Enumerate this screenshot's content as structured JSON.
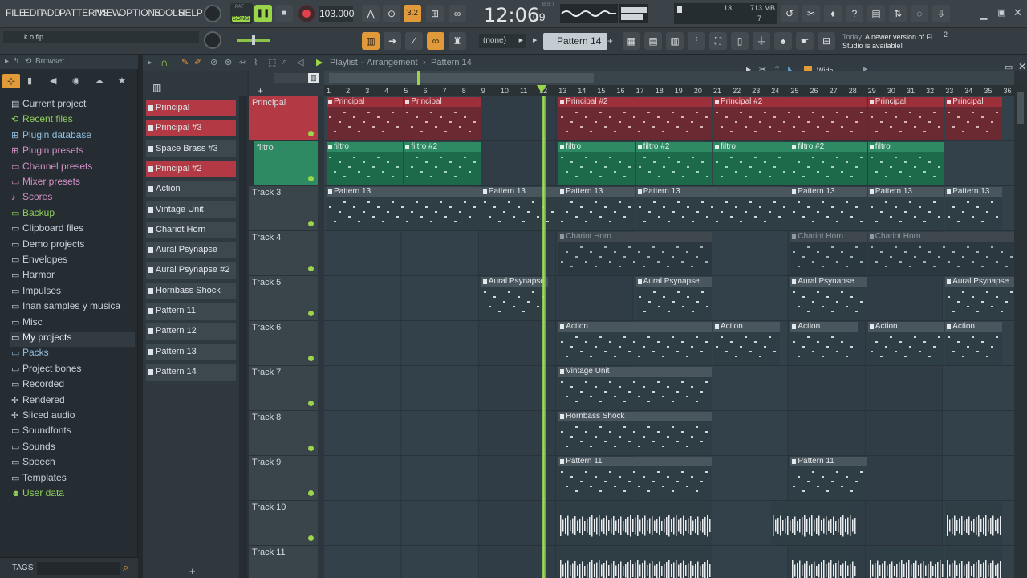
{
  "menu": [
    "FILE",
    "EDIT",
    "ADD",
    "PATTERNS",
    "VIEW",
    "OPTIONS",
    "TOOLS",
    "HELP"
  ],
  "transport": {
    "mode_top": "PAT",
    "mode_bottom": "SONG",
    "tempo": "103.000",
    "time": "12:06",
    "time_sub": "09",
    "time_label": "B:S:T",
    "step": "3.2"
  },
  "cpu": {
    "memory": "713 MB",
    "voices": "13",
    "polyphony": "7"
  },
  "hint_bar": {
    "file": "k.o.flp"
  },
  "toolbar2": {
    "snap": "(none)",
    "pattern": "Pattern 14",
    "news_date": "Today",
    "news_text": "A newer version of FL Studio is available!",
    "news_count": "2"
  },
  "browser": {
    "title": "Browser",
    "items": [
      {
        "label": "Current project",
        "icon": "project-icon",
        "color": "#c8d2d8"
      },
      {
        "label": "Recent files",
        "icon": "recent-icon",
        "color": "#8fd05b"
      },
      {
        "label": "Plugin database",
        "icon": "plugin-icon",
        "color": "#8fbfe0"
      },
      {
        "label": "Plugin presets",
        "icon": "plugin-preset-icon",
        "color": "#d390c7"
      },
      {
        "label": "Channel presets",
        "icon": "channel-preset-icon",
        "color": "#d390c7"
      },
      {
        "label": "Mixer presets",
        "icon": "mixer-preset-icon",
        "color": "#d390c7"
      },
      {
        "label": "Scores",
        "icon": "score-icon",
        "color": "#d390c7"
      },
      {
        "label": "Backup",
        "icon": "backup-icon",
        "color": "#8fd05b"
      },
      {
        "label": "Clipboard files",
        "icon": "folder-icon",
        "color": "#c8d2d8"
      },
      {
        "label": "Demo projects",
        "icon": "folder-icon",
        "color": "#c8d2d8"
      },
      {
        "label": "Envelopes",
        "icon": "folder-icon",
        "color": "#c8d2d8"
      },
      {
        "label": "Harmor",
        "icon": "folder-icon",
        "color": "#c8d2d8"
      },
      {
        "label": "Impulses",
        "icon": "folder-icon",
        "color": "#c8d2d8"
      },
      {
        "label": "Inan samples y musica",
        "icon": "folder-icon",
        "color": "#c8d2d8"
      },
      {
        "label": "Misc",
        "icon": "folder-icon",
        "color": "#c8d2d8"
      },
      {
        "label": "My projects",
        "icon": "folder-icon",
        "color": "#e8eef1"
      },
      {
        "label": "Packs",
        "icon": "pack-icon",
        "color": "#8fbfe0"
      },
      {
        "label": "Project bones",
        "icon": "project-bones-icon",
        "color": "#c8d2d8"
      },
      {
        "label": "Recorded",
        "icon": "recorded-icon",
        "color": "#c8d2d8"
      },
      {
        "label": "Rendered",
        "icon": "rendered-icon",
        "color": "#c8d2d8"
      },
      {
        "label": "Sliced audio",
        "icon": "sliced-icon",
        "color": "#c8d2d8"
      },
      {
        "label": "Soundfonts",
        "icon": "folder-icon",
        "color": "#c8d2d8"
      },
      {
        "label": "Sounds",
        "icon": "sounds-icon",
        "color": "#c8d2d8"
      },
      {
        "label": "Speech",
        "icon": "folder-icon",
        "color": "#c8d2d8"
      },
      {
        "label": "Templates",
        "icon": "folder-icon",
        "color": "#c8d2d8"
      },
      {
        "label": "User data",
        "icon": "user-icon",
        "color": "#8fd05b"
      }
    ],
    "footer": "TAGS"
  },
  "playlist": {
    "title": "Playlist",
    "breadcrumb1": "Arrangement",
    "breadcrumb2": "Pattern 14",
    "zoom": "Wide"
  },
  "channels": [
    {
      "label": "Principal",
      "red": true
    },
    {
      "label": "Principal #3",
      "red": true
    },
    {
      "label": "Space Brass #3",
      "red": false
    },
    {
      "label": "Principal #2",
      "red": true
    },
    {
      "label": "Action",
      "red": false
    },
    {
      "label": "Vintage Unit",
      "red": false
    },
    {
      "label": "Chariot Horn",
      "red": false
    },
    {
      "label": "Aural Psynapse",
      "red": false
    },
    {
      "label": "Aural Psynapse #2",
      "red": false
    },
    {
      "label": "Hornbass Shock",
      "red": false
    },
    {
      "label": "Pattern 11",
      "red": false
    },
    {
      "label": "Pattern 12",
      "red": false
    },
    {
      "label": "Pattern 13",
      "red": false
    },
    {
      "label": "Pattern 14",
      "red": false
    }
  ],
  "ruler": [
    "1",
    "2",
    "3",
    "4",
    "5",
    "6",
    "7",
    "8",
    "9",
    "10",
    "11",
    "12",
    "13",
    "14",
    "15",
    "16",
    "17",
    "18",
    "19",
    "20",
    "21",
    "22",
    "23",
    "24",
    "25",
    "26",
    "27",
    "28",
    "29",
    "30",
    "31",
    "32",
    "33",
    "34",
    "35",
    "36"
  ],
  "tracks": [
    {
      "label": "Principal",
      "color": "#b33a44"
    },
    {
      "label": "filtro",
      "color": "#2e8a62"
    },
    {
      "label": "Track 3",
      "color": "#3a444b"
    },
    {
      "label": "Track 4",
      "color": "#3a444b"
    },
    {
      "label": "Track 5",
      "color": "#3a444b"
    },
    {
      "label": "Track 6",
      "color": "#3a444b"
    },
    {
      "label": "Track 7",
      "color": "#3a444b"
    },
    {
      "label": "Track 8",
      "color": "#3a444b"
    },
    {
      "label": "Track 9",
      "color": "#3a444b"
    },
    {
      "label": "Track 10",
      "color": "#3a444b"
    },
    {
      "label": "Track 11",
      "color": "#3a444b"
    }
  ],
  "clips": [
    {
      "track": 0,
      "bar": 1,
      "len": 4,
      "label": "Principal",
      "kind": "red"
    },
    {
      "track": 0,
      "bar": 5,
      "len": 4,
      "label": "Principal",
      "kind": "red"
    },
    {
      "track": 0,
      "bar": 13,
      "len": 8,
      "label": "Principal #2",
      "kind": "red"
    },
    {
      "track": 0,
      "bar": 21,
      "len": 8,
      "label": "Principal #2",
      "kind": "red"
    },
    {
      "track": 0,
      "bar": 29,
      "len": 4,
      "label": "Principal",
      "kind": "red"
    },
    {
      "track": 0,
      "bar": 33,
      "len": 3,
      "label": "Principal",
      "kind": "red"
    },
    {
      "track": 1,
      "bar": 1,
      "len": 4,
      "label": "filtro",
      "kind": "green"
    },
    {
      "track": 1,
      "bar": 5,
      "len": 4,
      "label": "filtro #2",
      "kind": "green"
    },
    {
      "track": 1,
      "bar": 13,
      "len": 4,
      "label": "filtro",
      "kind": "green"
    },
    {
      "track": 1,
      "bar": 17,
      "len": 4,
      "label": "filtro #2",
      "kind": "green"
    },
    {
      "track": 1,
      "bar": 21,
      "len": 4,
      "label": "filtro",
      "kind": "green"
    },
    {
      "track": 1,
      "bar": 25,
      "len": 4,
      "label": "filtro #2",
      "kind": "green"
    },
    {
      "track": 1,
      "bar": 29,
      "len": 4,
      "label": "filtro",
      "kind": "green"
    },
    {
      "track": 2,
      "bar": 1,
      "len": 8,
      "label": "Pattern 13",
      "kind": "grey"
    },
    {
      "track": 2,
      "bar": 9,
      "len": 4,
      "label": "Pattern 13",
      "kind": "grey"
    },
    {
      "track": 2,
      "bar": 13,
      "len": 4,
      "label": "Pattern 13",
      "kind": "grey"
    },
    {
      "track": 2,
      "bar": 17,
      "len": 8,
      "label": "Pattern 13",
      "kind": "grey"
    },
    {
      "track": 2,
      "bar": 25,
      "len": 4,
      "label": "Pattern 13",
      "kind": "grey"
    },
    {
      "track": 2,
      "bar": 29,
      "len": 4,
      "label": "Pattern 13",
      "kind": "grey"
    },
    {
      "track": 2,
      "bar": 33,
      "len": 3,
      "label": "Pattern 13",
      "kind": "grey"
    },
    {
      "track": 3,
      "bar": 13,
      "len": 8,
      "label": "Chariot Horn",
      "kind": "muted"
    },
    {
      "track": 3,
      "bar": 25,
      "len": 4,
      "label": "Chariot Horn",
      "kind": "muted"
    },
    {
      "track": 3,
      "bar": 29,
      "len": 8,
      "label": "Chariot Horn",
      "kind": "muted"
    },
    {
      "track": 4,
      "bar": 9,
      "len": 3.5,
      "label": "Aural Psynapse",
      "kind": "grey"
    },
    {
      "track": 4,
      "bar": 17,
      "len": 4,
      "label": "Aural Psynapse",
      "kind": "grey"
    },
    {
      "track": 4,
      "bar": 25,
      "len": 4,
      "label": "Aural Psynapse",
      "kind": "grey"
    },
    {
      "track": 4,
      "bar": 33,
      "len": 4,
      "label": "Aural Psynapse",
      "kind": "grey"
    },
    {
      "track": 5,
      "bar": 13,
      "len": 8,
      "label": "Action",
      "kind": "grey"
    },
    {
      "track": 5,
      "bar": 21,
      "len": 3.5,
      "label": "Action",
      "kind": "grey"
    },
    {
      "track": 5,
      "bar": 25,
      "len": 3.5,
      "label": "Action",
      "kind": "grey"
    },
    {
      "track": 5,
      "bar": 29,
      "len": 4,
      "label": "Action",
      "kind": "grey"
    },
    {
      "track": 5,
      "bar": 33,
      "len": 3,
      "label": "Action",
      "kind": "grey"
    },
    {
      "track": 6,
      "bar": 13,
      "len": 8,
      "label": "Vintage Unit",
      "kind": "grey"
    },
    {
      "track": 7,
      "bar": 13,
      "len": 8,
      "label": "Hornbass Shock",
      "kind": "grey"
    },
    {
      "track": 8,
      "bar": 13,
      "len": 8,
      "label": "Pattern 11",
      "kind": "grey"
    },
    {
      "track": 8,
      "bar": 25,
      "len": 4,
      "label": "Pattern 11",
      "kind": "grey"
    },
    {
      "track": 9,
      "bar": 13,
      "len": 8,
      "label": "",
      "kind": "audio"
    },
    {
      "track": 9,
      "bar": 24,
      "len": 4.5,
      "label": "",
      "kind": "audio"
    },
    {
      "track": 9,
      "bar": 33,
      "len": 3,
      "label": "",
      "kind": "audio"
    },
    {
      "track": 10,
      "bar": 13,
      "len": 8,
      "label": "",
      "kind": "audio"
    },
    {
      "track": 10,
      "bar": 25,
      "len": 3.5,
      "label": "",
      "kind": "audio"
    },
    {
      "track": 10,
      "bar": 29,
      "len": 4,
      "label": "",
      "kind": "audio"
    },
    {
      "track": 10,
      "bar": 33,
      "len": 3,
      "label": "",
      "kind": "audio"
    }
  ],
  "playhead_bar": 12.1
}
